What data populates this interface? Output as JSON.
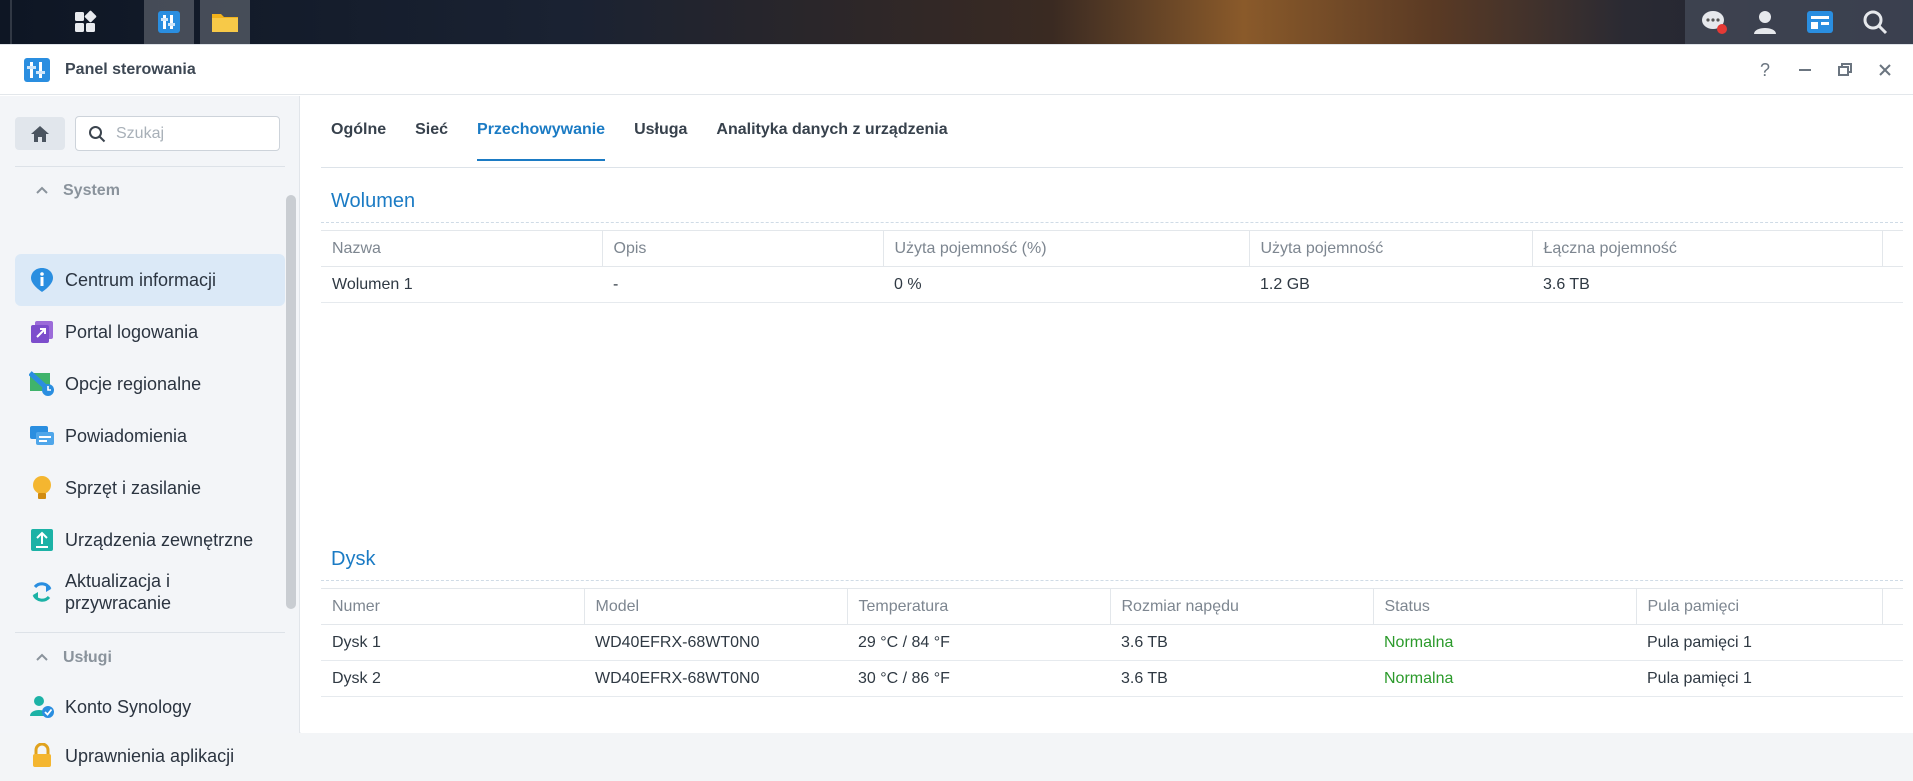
{
  "window": {
    "title": "Panel sterowania"
  },
  "search": {
    "placeholder": "Szukaj"
  },
  "sidebar": {
    "sections": [
      {
        "label": "System"
      },
      {
        "label": "Usługi"
      }
    ],
    "items": [
      {
        "label": "Centrum informacji",
        "icon": "info-icon"
      },
      {
        "label": "Portal logowania",
        "icon": "login-portal-icon"
      },
      {
        "label": "Opcje regionalne",
        "icon": "regional-options-icon"
      },
      {
        "label": "Powiadomienia",
        "icon": "notifications-icon"
      },
      {
        "label": "Sprzęt i zasilanie",
        "icon": "lightbulb-icon"
      },
      {
        "label": "Urządzenia zewnętrzne",
        "icon": "external-devices-icon"
      },
      {
        "label": "Aktualizacja i przywracanie",
        "icon": "update-restore-icon"
      },
      {
        "label": "Konto Synology",
        "icon": "synology-account-icon"
      },
      {
        "label": "Uprawnienia aplikacji",
        "icon": "lock-icon"
      }
    ]
  },
  "tabs": [
    {
      "label": "Ogólne"
    },
    {
      "label": "Sieć"
    },
    {
      "label": "Przechowywanie",
      "active": true
    },
    {
      "label": "Usługa"
    },
    {
      "label": "Analityka danych z urządzenia"
    }
  ],
  "volume": {
    "title": "Wolumen",
    "columns": [
      "Nazwa",
      "Opis",
      "Użyta pojemność (%)",
      "Użyta pojemność",
      "Łączna pojemność"
    ],
    "rows": [
      [
        "Wolumen 1",
        "-",
        "0 %",
        "1.2 GB",
        "3.6 TB"
      ]
    ]
  },
  "disk": {
    "title": "Dysk",
    "columns": [
      "Numer",
      "Model",
      "Temperatura",
      "Rozmiar napędu",
      "Status",
      "Pula pamięci"
    ],
    "rows": [
      [
        "Dysk 1",
        "WD40EFRX-68WT0N0",
        "29 °C / 84 °F",
        "3.6 TB",
        "Normalna",
        "Pula pamięci 1"
      ],
      [
        "Dysk 2",
        "WD40EFRX-68WT0N0",
        "30 °C / 86 °F",
        "3.6 TB",
        "Normalna",
        "Pula pamięci 1"
      ]
    ]
  },
  "colors": {
    "accent": "#1b7bc4",
    "status_ok": "#2b9a2b"
  }
}
